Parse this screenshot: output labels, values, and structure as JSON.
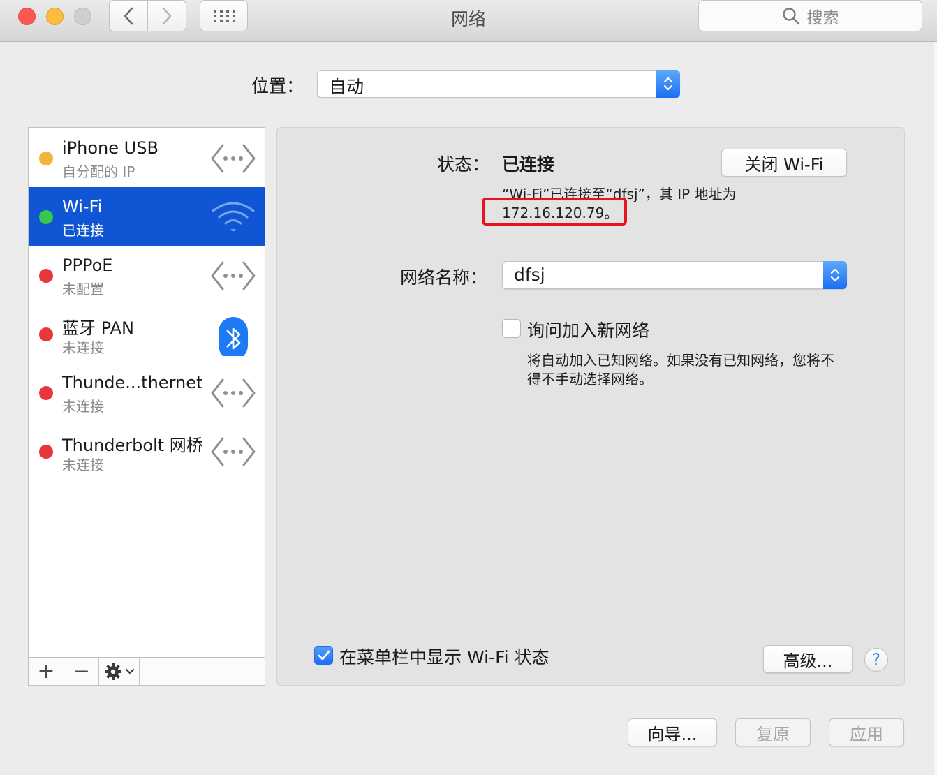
{
  "window": {
    "title": "网络",
    "search_placeholder": "搜索"
  },
  "location": {
    "label": "位置：",
    "value": "自动"
  },
  "services": [
    {
      "name": "iPhone USB",
      "status": "自分配的 IP",
      "dot_color": "#f5b53a",
      "icon": "ethernet-arrows-icon"
    },
    {
      "name": "Wi-Fi",
      "status": "已连接",
      "dot_color": "#3ac84a",
      "icon": "wifi-icon"
    },
    {
      "name": "PPPoE",
      "status": "未配置",
      "dot_color": "#e8363d",
      "icon": "ethernet-arrows-icon"
    },
    {
      "name": "蓝牙 PAN",
      "status": "未连接",
      "dot_color": "#e8363d",
      "icon": "bluetooth-icon"
    },
    {
      "name": "Thunde...thernet",
      "status": "未连接",
      "dot_color": "#e8363d",
      "icon": "ethernet-arrows-icon"
    },
    {
      "name": "Thunderbolt 网桥",
      "status": "未连接",
      "dot_color": "#e8363d",
      "icon": "ethernet-arrows-icon"
    }
  ],
  "sidebar_tools": {
    "add": "+",
    "remove": "−"
  },
  "detail": {
    "status_label": "状态：",
    "status_value": "已连接",
    "turn_off_button": "关闭 Wi-Fi",
    "status_desc_line1": "“Wi-Fi”已连接至“dfsj”，其 IP 地址为",
    "status_desc_line2": "172.16.120.79。",
    "network_name_label": "网络名称：",
    "network_name_value": "dfsj",
    "ask_join_label": "询问加入新网络",
    "ask_join_desc_line1": "将自动加入已知网络。如果没有已知网络，您将不",
    "ask_join_desc_line2": "得不手动选择网络。",
    "show_in_menubar_label": "在菜单栏中显示 Wi-Fi 状态",
    "advanced_button": "高级...",
    "help": "?"
  },
  "footer": {
    "assist_button": "向导...",
    "revert_button": "复原",
    "apply_button": "应用"
  },
  "colors": {
    "accent": "#1d6ff2",
    "selection": "#0f55d4",
    "highlight_box": "#e7141d"
  }
}
